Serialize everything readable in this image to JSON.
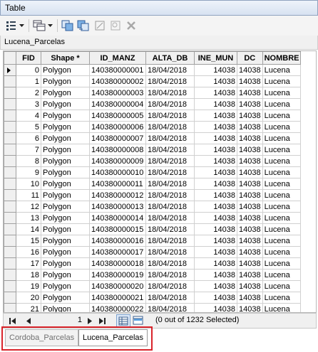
{
  "window": {
    "title": "Table"
  },
  "toolbar": {
    "items": [
      "table-options-icon",
      "dropdown-arrow-icon",
      "related-tables-icon",
      "dropdown-arrow-icon",
      "select-by-attributes-icon",
      "switch-selection-icon",
      "clear-selection-icon",
      "zoom-to-selected-icon",
      "delete-selected-icon"
    ]
  },
  "table_name": "Lucena_Parcelas",
  "grid": {
    "columns": [
      "FID",
      "Shape *",
      "ID_MANZ",
      "ALTA_DB",
      "INE_MUN",
      "DC",
      "NOMBRE"
    ],
    "rows": [
      [
        "0",
        "Polygon",
        "140380000001",
        "18/04/2018",
        "14038",
        "14038",
        "Lucena"
      ],
      [
        "1",
        "Polygon",
        "140380000002",
        "18/04/2018",
        "14038",
        "14038",
        "Lucena"
      ],
      [
        "2",
        "Polygon",
        "140380000003",
        "18/04/2018",
        "14038",
        "14038",
        "Lucena"
      ],
      [
        "3",
        "Polygon",
        "140380000004",
        "18/04/2018",
        "14038",
        "14038",
        "Lucena"
      ],
      [
        "4",
        "Polygon",
        "140380000005",
        "18/04/2018",
        "14038",
        "14038",
        "Lucena"
      ],
      [
        "5",
        "Polygon",
        "140380000006",
        "18/04/2018",
        "14038",
        "14038",
        "Lucena"
      ],
      [
        "6",
        "Polygon",
        "140380000007",
        "18/04/2018",
        "14038",
        "14038",
        "Lucena"
      ],
      [
        "7",
        "Polygon",
        "140380000008",
        "18/04/2018",
        "14038",
        "14038",
        "Lucena"
      ],
      [
        "8",
        "Polygon",
        "140380000009",
        "18/04/2018",
        "14038",
        "14038",
        "Lucena"
      ],
      [
        "9",
        "Polygon",
        "140380000010",
        "18/04/2018",
        "14038",
        "14038",
        "Lucena"
      ],
      [
        "10",
        "Polygon",
        "140380000011",
        "18/04/2018",
        "14038",
        "14038",
        "Lucena"
      ],
      [
        "11",
        "Polygon",
        "140380000012",
        "18/04/2018",
        "14038",
        "14038",
        "Lucena"
      ],
      [
        "12",
        "Polygon",
        "140380000013",
        "18/04/2018",
        "14038",
        "14038",
        "Lucena"
      ],
      [
        "13",
        "Polygon",
        "140380000014",
        "18/04/2018",
        "14038",
        "14038",
        "Lucena"
      ],
      [
        "14",
        "Polygon",
        "140380000015",
        "18/04/2018",
        "14038",
        "14038",
        "Lucena"
      ],
      [
        "15",
        "Polygon",
        "140380000016",
        "18/04/2018",
        "14038",
        "14038",
        "Lucena"
      ],
      [
        "16",
        "Polygon",
        "140380000017",
        "18/04/2018",
        "14038",
        "14038",
        "Lucena"
      ],
      [
        "17",
        "Polygon",
        "140380000018",
        "18/04/2018",
        "14038",
        "14038",
        "Lucena"
      ],
      [
        "18",
        "Polygon",
        "140380000019",
        "18/04/2018",
        "14038",
        "14038",
        "Lucena"
      ],
      [
        "19",
        "Polygon",
        "140380000020",
        "18/04/2018",
        "14038",
        "14038",
        "Lucena"
      ],
      [
        "20",
        "Polygon",
        "140380000021",
        "18/04/2018",
        "14038",
        "14038",
        "Lucena"
      ],
      [
        "21",
        "Polygon",
        "140380000022",
        "18/04/2018",
        "14038",
        "14038",
        "Lucena"
      ]
    ],
    "current_row": "0"
  },
  "navigation": {
    "first_icon": "first-record-icon",
    "prev_icon": "previous-record-icon",
    "current_record": "1",
    "next_icon": "next-record-icon",
    "last_icon": "last-record-icon",
    "show_all_icon": "show-all-records-icon",
    "show_selected_icon": "show-selected-records-icon",
    "selection_status": "(0 out of 1232 Selected)"
  },
  "tabs": [
    {
      "label": "Cordoba_Parcelas",
      "active": false
    },
    {
      "label": "Lucena_Parcelas",
      "active": true
    }
  ],
  "colors": {
    "highlight_box": "#d9242b",
    "header_bg": "#f0f0f0"
  }
}
